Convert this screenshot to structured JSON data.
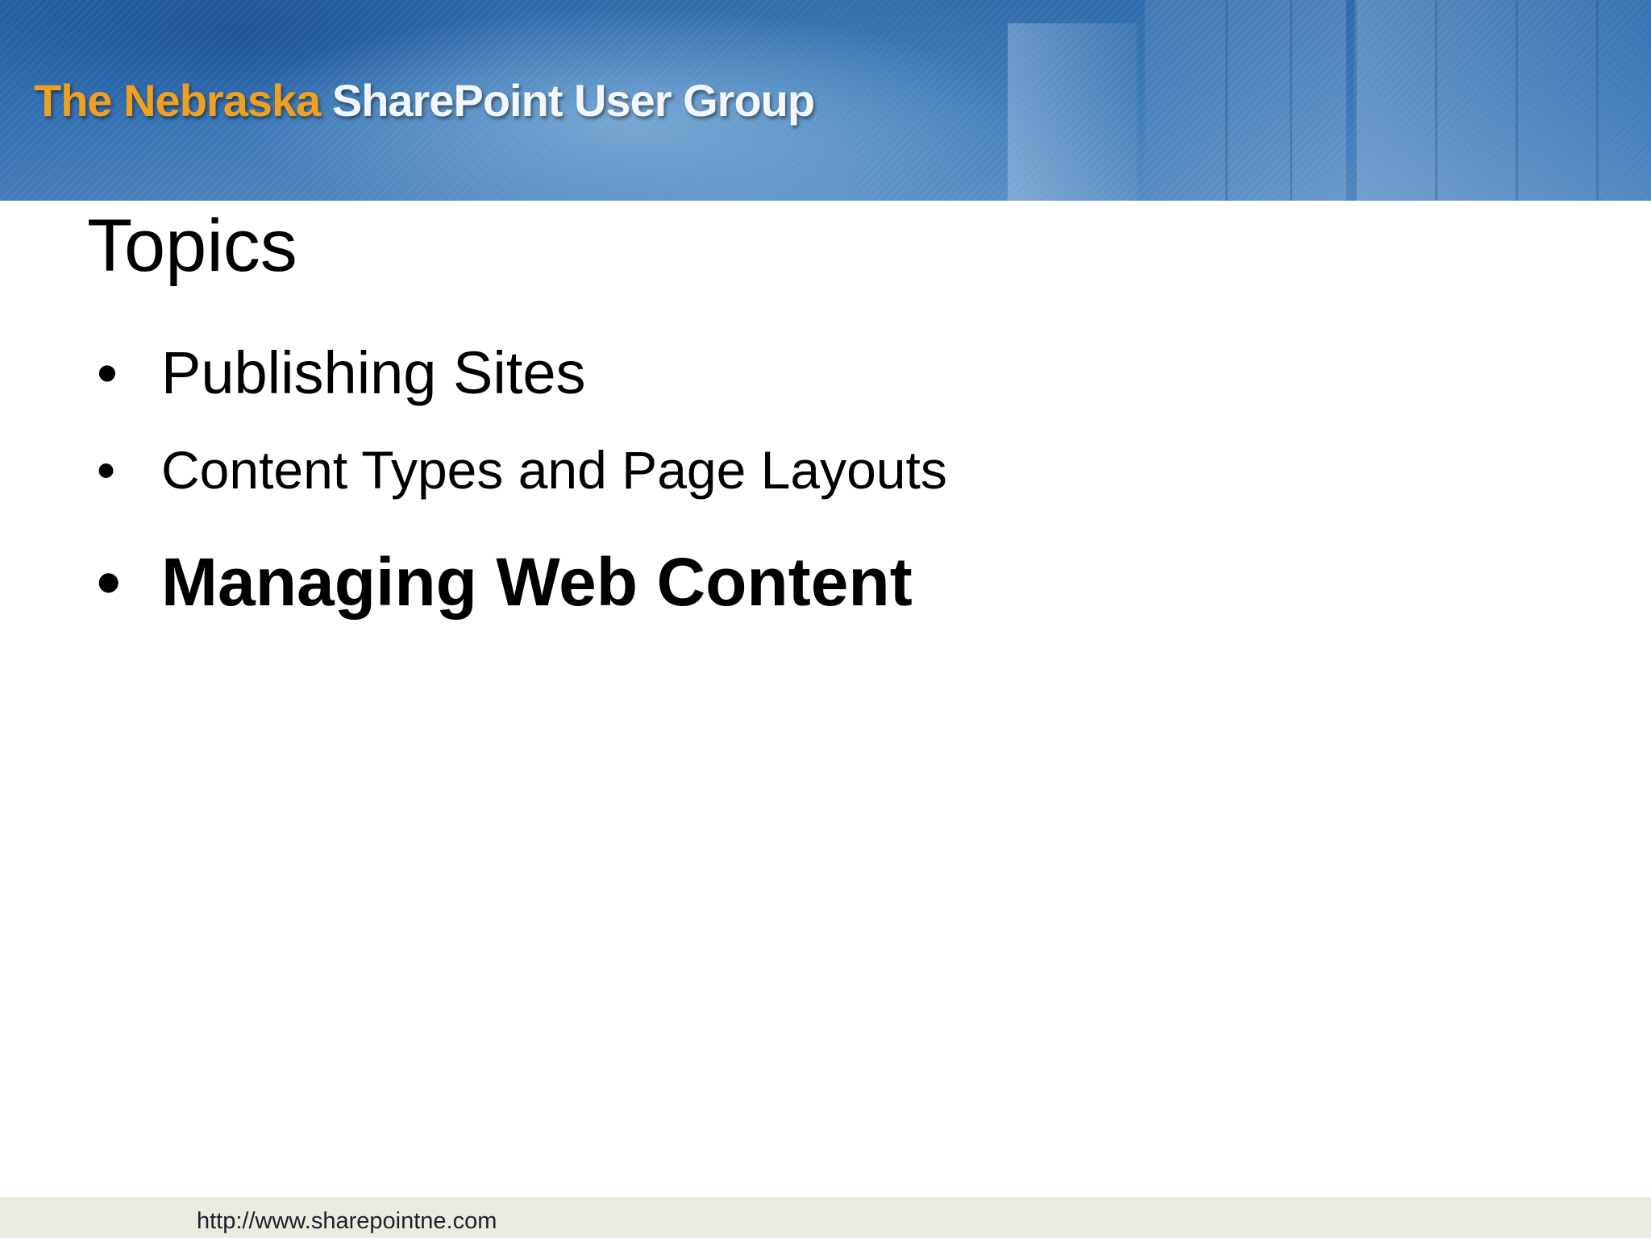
{
  "header": {
    "logo_part1": "The Nebraska",
    "logo_part2": "SharePoint User Group",
    "colors": {
      "logo_orange": "#f0a020",
      "logo_white": "#f2f6fa",
      "banner_blue": "#3c7bb8"
    }
  },
  "slide": {
    "title": "Topics",
    "bullets": [
      {
        "marker": "•",
        "text": "Publishing Sites",
        "emphasis": false
      },
      {
        "marker": "•",
        "text": "Content Types and Page Layouts",
        "emphasis": false
      },
      {
        "marker": "•",
        "text": "Managing Web Content",
        "emphasis": true
      }
    ]
  },
  "footer": {
    "url": "http://www.sharepointne.com",
    "background_color": "#ecebe0"
  }
}
